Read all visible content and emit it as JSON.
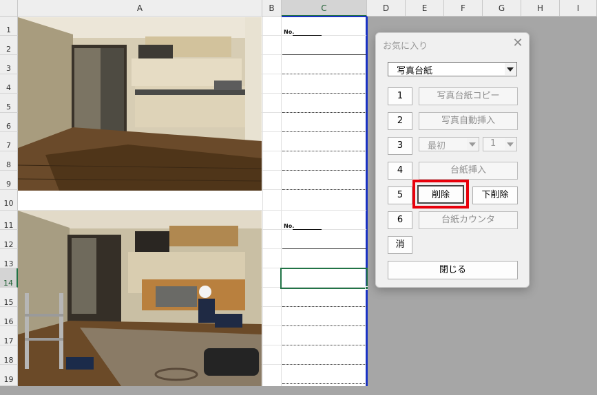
{
  "columns": [
    "A",
    "B",
    "C",
    "D",
    "E",
    "F",
    "G",
    "H",
    "I"
  ],
  "rows": [
    "1",
    "2",
    "3",
    "4",
    "5",
    "6",
    "7",
    "8",
    "9",
    "10",
    "11",
    "12",
    "13",
    "14",
    "15",
    "16",
    "17",
    "18",
    "19"
  ],
  "sheet": {
    "no_label_1": "No.",
    "no_label_2": "No."
  },
  "dialog": {
    "title": "お気に入り",
    "close": "✕",
    "combo_value": "写真台紙",
    "num1": "1",
    "btn1": "写真台紙コピー",
    "num2": "2",
    "btn2": "写真自動挿入",
    "num3": "3",
    "combo3a": "最初",
    "combo3b": "1",
    "num4": "4",
    "btn4": "台紙挿入",
    "num5": "5",
    "btn5a": "削除",
    "btn5b": "下削除",
    "num6": "6",
    "btn6": "台紙カウンタ",
    "clear": "消",
    "closeBtn": "閉じる"
  },
  "highlight_color": "#e8000b"
}
